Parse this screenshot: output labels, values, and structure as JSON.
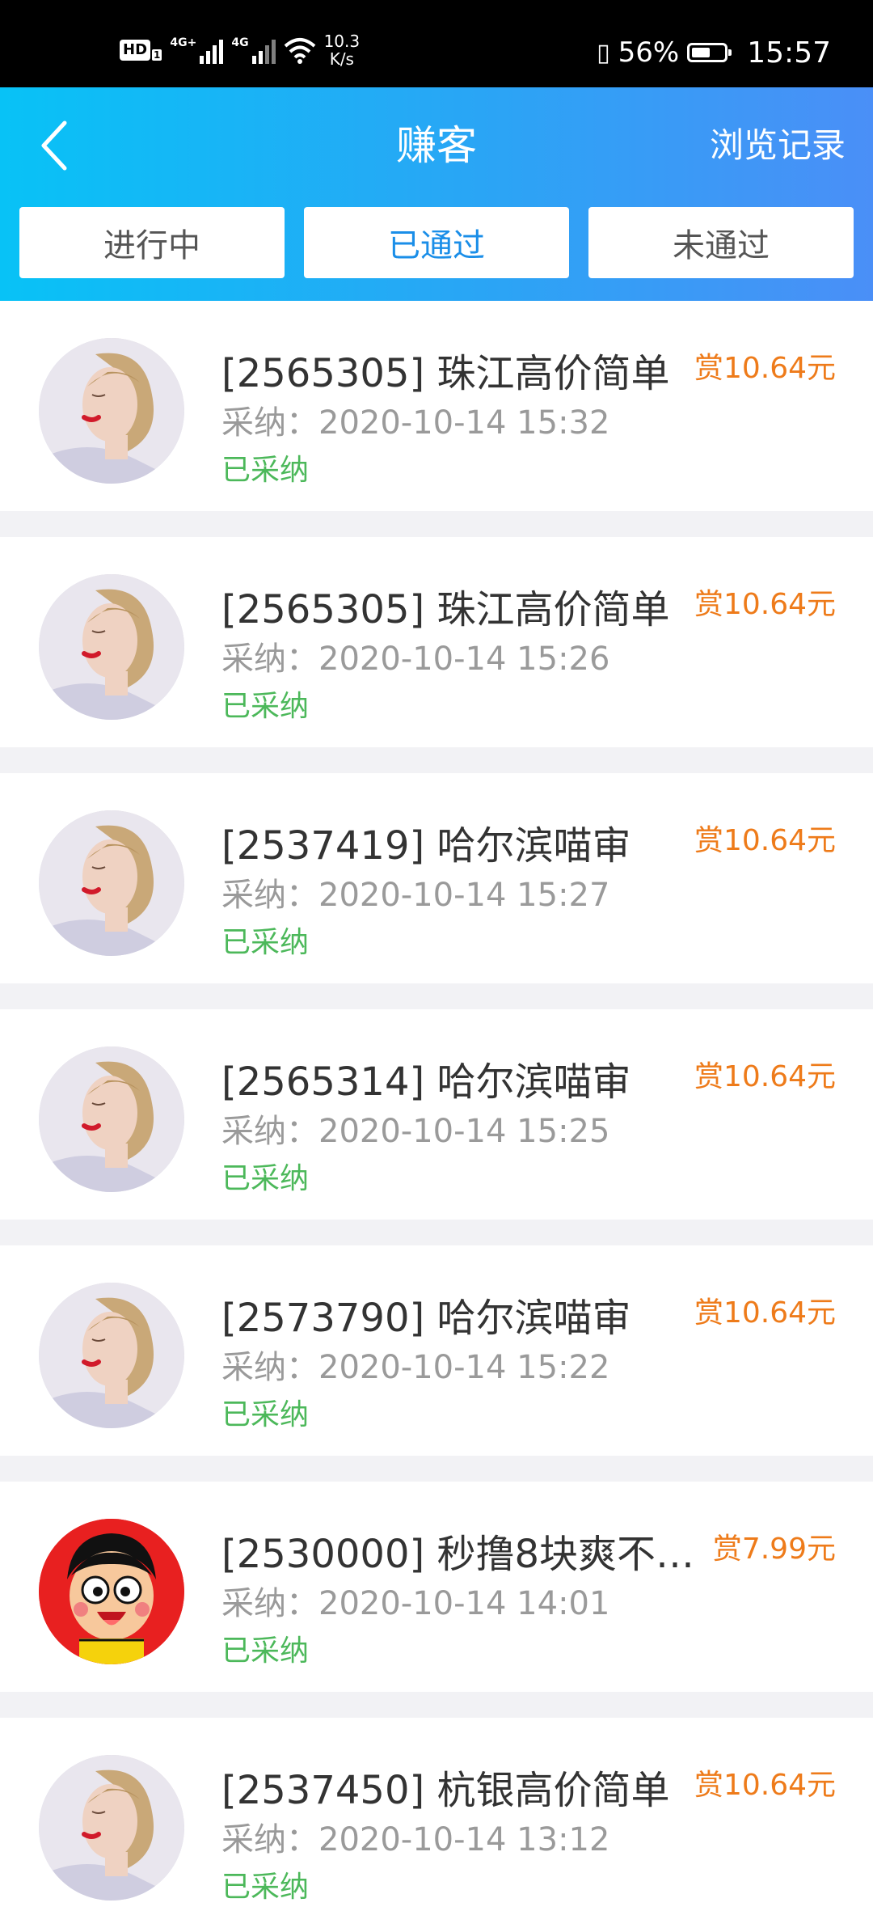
{
  "status_bar": {
    "hd_label": "HD",
    "hd_sub": "1",
    "sim1_label": "4G+",
    "sim2_label": "4G",
    "speed_value": "10.3",
    "speed_unit": "K/s",
    "battery_percent": "56%",
    "battery_level": 0.56,
    "time": "15:57"
  },
  "header": {
    "title": "赚客",
    "history_link": "浏览记录",
    "back_icon": "chevron-left-icon",
    "gradient_start": "#08c2f6",
    "gradient_end": "#4a8ff7"
  },
  "tabs": [
    {
      "label": "进行中",
      "active": false
    },
    {
      "label": "已通过",
      "active": true
    },
    {
      "label": "未通过",
      "active": false
    }
  ],
  "colors": {
    "active_tab": "#1a8ee8",
    "reward": "#ee7b1a",
    "status": "#4cb85a"
  },
  "list": [
    {
      "title": "[2565305] 珠江高价简单",
      "time": "采纳：2020-10-14 15:32",
      "status": "已采纳",
      "reward": "赏10.64元",
      "avatar": "portrait"
    },
    {
      "title": "[2565305] 珠江高价简单",
      "time": "采纳：2020-10-14 15:26",
      "status": "已采纳",
      "reward": "赏10.64元",
      "avatar": "portrait"
    },
    {
      "title": "[2537419] 哈尔滨喵审",
      "time": "采纳：2020-10-14 15:27",
      "status": "已采纳",
      "reward": "赏10.64元",
      "avatar": "portrait"
    },
    {
      "title": "[2565314] 哈尔滨喵审",
      "time": "采纳：2020-10-14 15:25",
      "status": "已采纳",
      "reward": "赏10.64元",
      "avatar": "portrait"
    },
    {
      "title": "[2573790] 哈尔滨喵审",
      "time": "采纳：2020-10-14 15:22",
      "status": "已采纳",
      "reward": "赏10.64元",
      "avatar": "portrait"
    },
    {
      "title": "[2530000] 秒撸8块爽不爽…",
      "time": "采纳：2020-10-14 14:01",
      "status": "已采纳",
      "reward": "赏7.99元",
      "avatar": "cartoon"
    },
    {
      "title": "[2537450] 杭银高价简单",
      "time": "采纳：2020-10-14 13:12",
      "status": "已采纳",
      "reward": "赏10.64元",
      "avatar": "portrait"
    }
  ]
}
